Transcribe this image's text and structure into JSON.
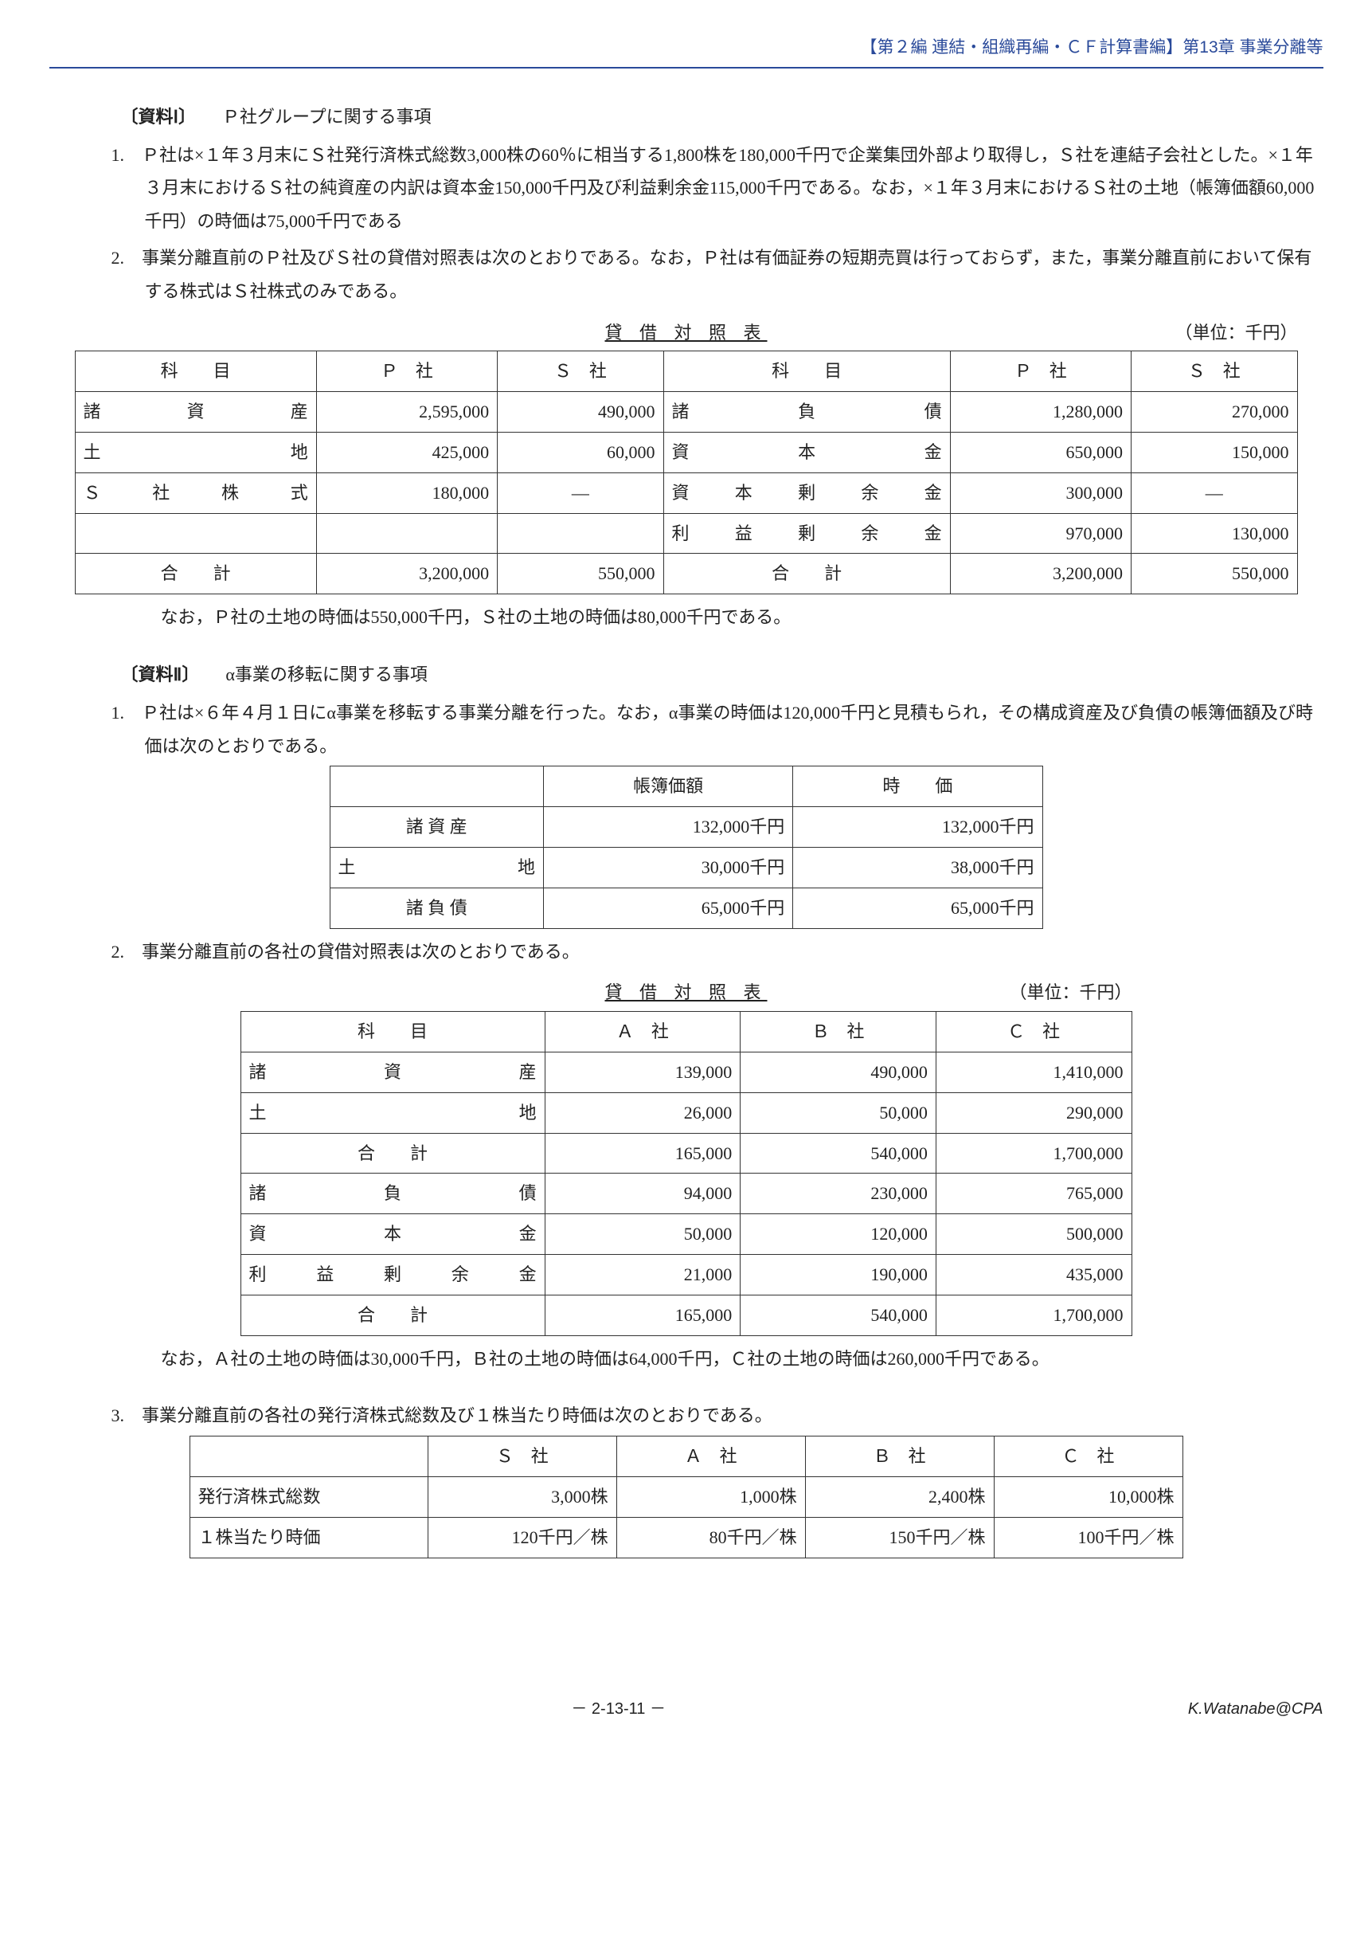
{
  "header": "【第２編 連結・組織再編・ＣＦ計算書編】第13章 事業分離等",
  "mat1": {
    "title_pre": "〔資料Ⅰ〕",
    "title": "　　Ｐ社グループに関する事項",
    "item1": "1.　Ｐ社は×１年３月末にＳ社発行済株式総数3,000株の60％に相当する1,800株を180,000千円で企業集団外部より取得し，Ｓ社を連結子会社とした。×１年３月末におけるＳ社の純資産の内訳は資本金150,000千円及び利益剰余金115,000千円である。なお，×１年３月末におけるＳ社の土地（帳簿価額60,000千円）の時価は75,000千円である",
    "item2": "2.　事業分離直前のＰ社及びＳ社の貸借対照表は次のとおりである。なお，Ｐ社は有価証券の短期売買は行っておらず，また，事業分離直前において保有する株式はＳ社株式のみである。",
    "bs_caption": "貸 借 対 照 表",
    "bs_unit": "（単位：千円）",
    "bs1": {
      "h1": "科　　目",
      "h2": "Ｐ　社",
      "h3": "Ｓ　社",
      "h4": "科　　目",
      "h5": "Ｐ　社",
      "h6": "Ｓ　社",
      "r1a": "諸資産",
      "r1p": "2,595,000",
      "r1s": "490,000",
      "r1b": "諸負債",
      "r1bp": "1,280,000",
      "r1bs": "270,000",
      "r2a": "土地",
      "r2p": "425,000",
      "r2s": "60,000",
      "r2b": "資本金",
      "r2bp": "650,000",
      "r2bs": "150,000",
      "r3a": "Ｓ 社 株 式",
      "r3p": "180,000",
      "r3s": "―",
      "r3b": "資 本 剰 余 金",
      "r3bp": "300,000",
      "r3bs": "―",
      "r4b": "利 益 剰 余 金",
      "r4bp": "970,000",
      "r4bs": "130,000",
      "tot": "合　　計",
      "totp": "3,200,000",
      "tots": "550,000",
      "totbp": "3,200,000",
      "totbs": "550,000"
    },
    "note1": "なお，Ｐ社の土地の時価は550,000千円，Ｓ社の土地の時価は80,000千円である。"
  },
  "mat2": {
    "title_pre": "〔資料Ⅱ〕",
    "title": "　　α事業の移転に関する事項",
    "item1": "1.　Ｐ社は×６年４月１日にα事業を移転する事業分離を行った。なお，α事業の時価は120,000千円と見積もられ，その構成資産及び負債の帳簿価額及び時価は次のとおりである。",
    "t2": {
      "h1": "帳簿価額",
      "h2": "時　　価",
      "r1a": "諸 資 産",
      "r1b": "132,000千円",
      "r1c": "132,000千円",
      "r2a": "土　　地",
      "r2b": "30,000千円",
      "r2c": "38,000千円",
      "r3a": "諸 負 債",
      "r3b": "65,000千円",
      "r3c": "65,000千円"
    },
    "item2": "2.　事業分離直前の各社の貸借対照表は次のとおりである。",
    "bs_caption": "貸 借 対 照 表",
    "bs_unit": "（単位：千円）",
    "bs3": {
      "h1": "科　　目",
      "h2": "Ａ　社",
      "h3": "Ｂ　社",
      "h4": "Ｃ　社",
      "r1a": "諸資産",
      "r1b": "139,000",
      "r1c": "490,000",
      "r1d": "1,410,000",
      "r2a": "土地",
      "r2b": "26,000",
      "r2c": "50,000",
      "r2d": "290,000",
      "st1": "合　　計",
      "st1b": "165,000",
      "st1c": "540,000",
      "st1d": "1,700,000",
      "r3a": "諸負債",
      "r3b": "94,000",
      "r3c": "230,000",
      "r3d": "765,000",
      "r4a": "資本金",
      "r4b": "50,000",
      "r4c": "120,000",
      "r4d": "500,000",
      "r5a": "利 益 剰 余 金",
      "r5b": "21,000",
      "r5c": "190,000",
      "r5d": "435,000",
      "st2": "合　　計",
      "st2b": "165,000",
      "st2c": "540,000",
      "st2d": "1,700,000"
    },
    "note2": "なお，Ａ社の土地の時価は30,000千円，Ｂ社の土地の時価は64,000千円，Ｃ社の土地の時価は260,000千円である。",
    "item3": "3.　事業分離直前の各社の発行済株式総数及び１株当たり時価は次のとおりである。",
    "t4": {
      "h1": "Ｓ　社",
      "h2": "Ａ　社",
      "h3": "Ｂ　社",
      "h4": "Ｃ　社",
      "r1a": "発行済株式総数",
      "r1b": "3,000株",
      "r1c": "1,000株",
      "r1d": "2,400株",
      "r1e": "10,000株",
      "r2a": "１株当たり時価",
      "r2b": "120千円／株",
      "r2c": "80千円／株",
      "r2d": "150千円／株",
      "r2e": "100千円／株"
    }
  },
  "footer": {
    "page": "－ 2-13-11 －",
    "credit": "K.Watanabe@CPA"
  }
}
